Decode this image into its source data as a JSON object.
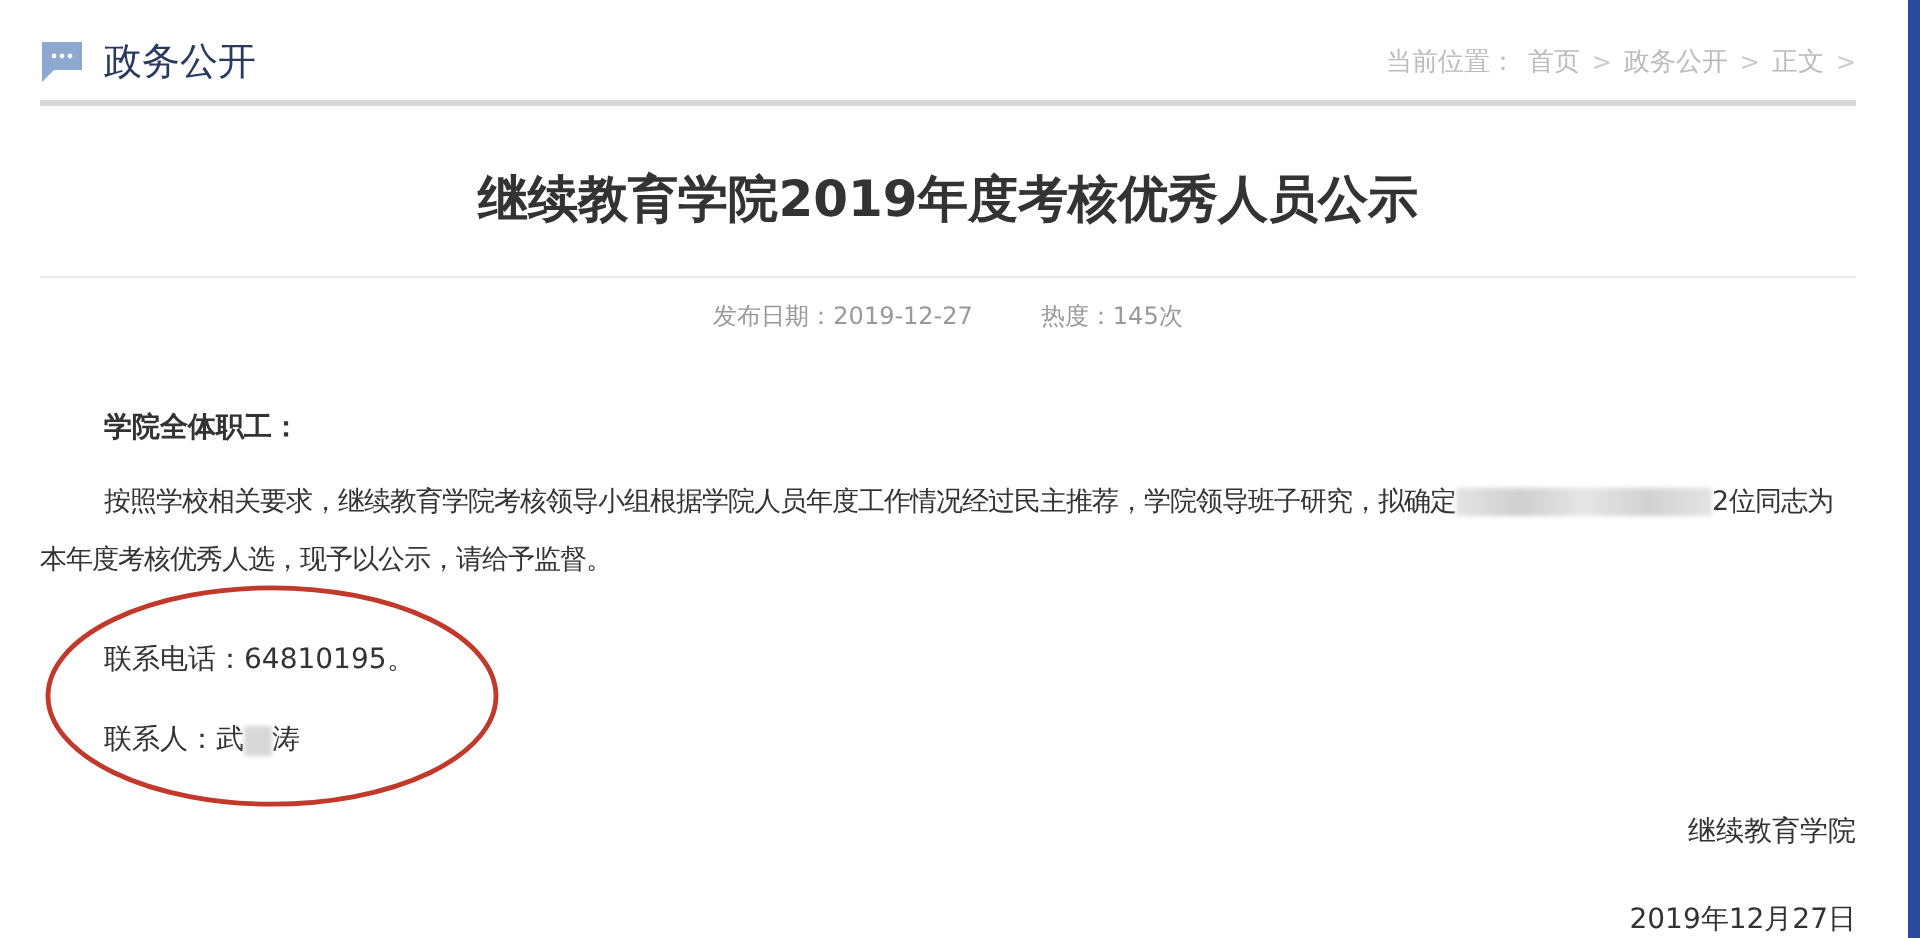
{
  "header": {
    "section_title": "政务公开",
    "breadcrumb": [
      {
        "label": "当前位置："
      },
      {
        "label": "首页",
        "separator": ">"
      },
      {
        "label": "政务公开",
        "separator": ">"
      },
      {
        "label": "正文",
        "separator": ">"
      }
    ]
  },
  "article": {
    "title": "继续教育学院2019年度考核优秀人员公示",
    "publish_date": "发布日期：2019-12-27",
    "views": "热度：145次",
    "salutation": "学院全体职工：",
    "paragraph": {
      "before_redaction": "按照学校相关要求，继续教育学院考核领导小组根据学院人员年度工作情况经过民主推荐，学院领导班子研究，拟确定",
      "after_redaction": "2位同志为",
      "next_line": "本年度考核优秀人选，现予以公示，请给予监督。"
    },
    "phone": "联系电话：64810195。",
    "contact": {
      "before_redaction": "联系人：武",
      "after_redaction": "涛"
    },
    "signature": "继续教育学院",
    "date": "2019年12月27日"
  }
}
